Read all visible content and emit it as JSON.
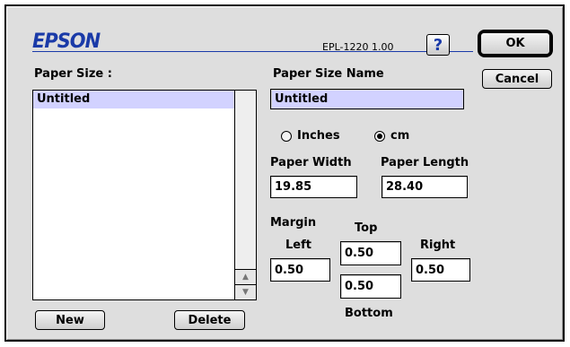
{
  "brand": "EPSON",
  "model": "EPL-1220  1.00",
  "help_label": "?",
  "buttons": {
    "ok": "OK",
    "cancel": "Cancel",
    "new": "New",
    "delete": "Delete"
  },
  "paper_size": {
    "label": "Paper Size :",
    "items": [
      "Untitled"
    ],
    "selected": "Untitled"
  },
  "paper_size_name": {
    "label": "Paper Size Name",
    "value": "Untitled"
  },
  "units": {
    "inches": "Inches",
    "cm": "cm",
    "selected": "cm"
  },
  "paper_width": {
    "label": "Paper Width",
    "value": "19.85"
  },
  "paper_length": {
    "label": "Paper Length",
    "value": "28.40"
  },
  "margin": {
    "label": "Margin",
    "top_label": "Top",
    "top": "0.50",
    "left_label": "Left",
    "left": "0.50",
    "right_label": "Right",
    "right": "0.50",
    "bottom_label": "Bottom",
    "bottom": "0.50"
  },
  "scroll_icons": {
    "up": "scroll-up-arrow-icon",
    "down": "scroll-down-arrow-icon"
  }
}
